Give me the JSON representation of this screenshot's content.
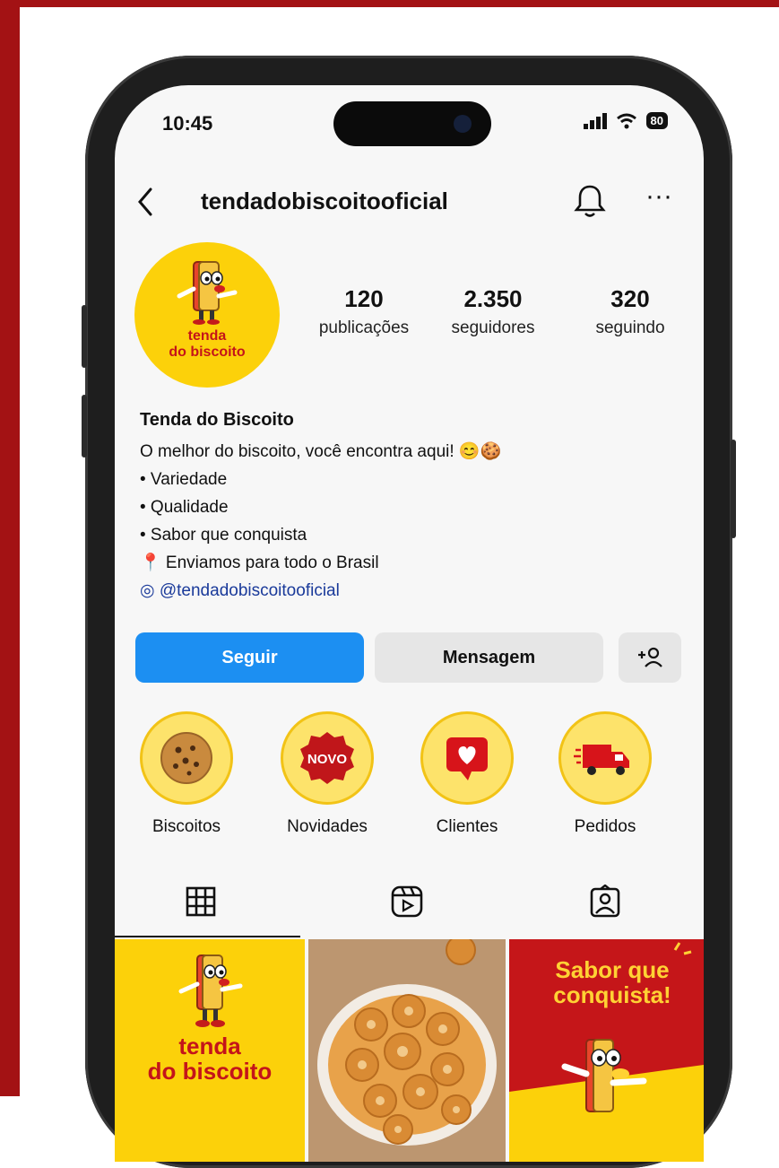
{
  "status": {
    "time": "10:45",
    "battery": "80"
  },
  "profile": {
    "username": "tendadobiscoitooficial",
    "avatar_text_line1": "tenda",
    "avatar_text_line2": "do biscoito",
    "stats": [
      {
        "value": "120",
        "label": "publicações"
      },
      {
        "value": "2.350",
        "label": "seguidores"
      },
      {
        "value": "320",
        "label": "seguindo"
      }
    ],
    "name": "Tenda do Biscoito",
    "bio_lines": [
      "O melhor do biscoito, você encontra aqui! 😊🍪",
      "• Variedade",
      "• Qualidade",
      "• Sabor que conquista",
      "📍 Enviamos para todo o Brasil"
    ],
    "link": "@tendadobiscoitooficial"
  },
  "actions": {
    "follow": "Seguir",
    "message": "Mensagem",
    "add_person": "+"
  },
  "highlights": [
    {
      "label": "Biscoitos",
      "icon": "cookie-icon"
    },
    {
      "label": "Novidades",
      "icon": "novo-badge-icon",
      "badge_text": "NOVO"
    },
    {
      "label": "Clientes",
      "icon": "heart-chat-icon"
    },
    {
      "label": "Pedidos",
      "icon": "delivery-truck-icon"
    }
  ],
  "posts": [
    {
      "line1": "tenda",
      "line2": "do biscoito"
    },
    {
      "subject": "bowl of biscuits"
    },
    {
      "line1": "Sabor que",
      "line2": "conquista!"
    }
  ],
  "colors": {
    "brand_red": "#a31214",
    "brand_yellow": "#fcd10a",
    "follow_blue": "#1c8ff2"
  }
}
